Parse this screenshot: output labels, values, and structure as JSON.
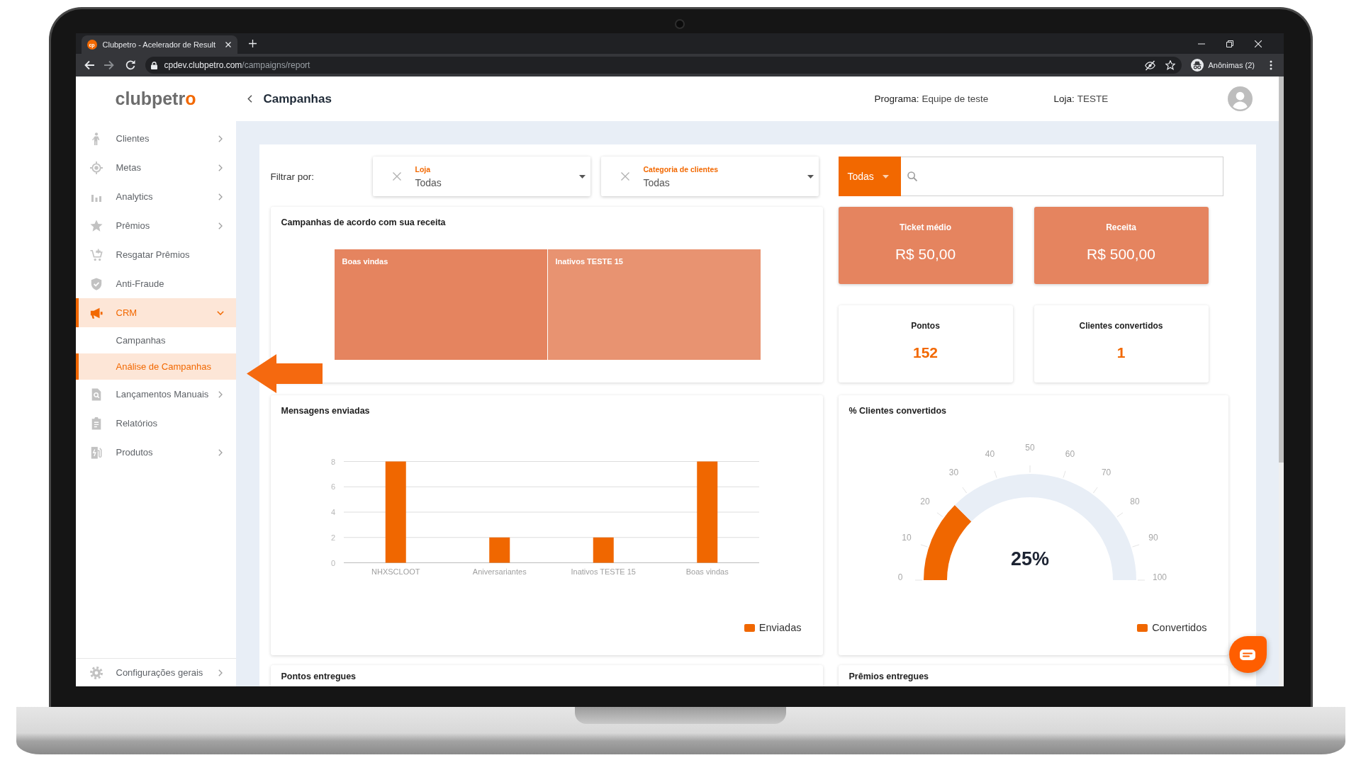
{
  "browser": {
    "favicon_text": "cp",
    "tab_title": "Clubpetro - Acelerador de Result",
    "url_host": "cpdev.clubpetro.com",
    "url_path": "/campaigns/report",
    "profile": "Anônimas (2)"
  },
  "sidebar": {
    "logo": "clubpetro",
    "items": [
      {
        "label": "Clientes",
        "expandable": true,
        "expanded": false,
        "selected": false
      },
      {
        "label": "Metas",
        "expandable": true,
        "expanded": false,
        "selected": false
      },
      {
        "label": "Analytics",
        "expandable": true,
        "expanded": false,
        "selected": false
      },
      {
        "label": "Prêmios",
        "expandable": true,
        "expanded": false,
        "selected": false
      },
      {
        "label": "Resgatar Prêmios",
        "expandable": false,
        "expanded": false,
        "selected": false
      },
      {
        "label": "Anti-Fraude",
        "expandable": false,
        "expanded": false,
        "selected": false
      },
      {
        "label": "CRM",
        "expandable": true,
        "expanded": true,
        "selected": true,
        "children": [
          {
            "label": "Campanhas",
            "selected": false
          },
          {
            "label": "Análise de Campanhas",
            "selected": true
          }
        ]
      },
      {
        "label": "Lançamentos Manuais",
        "expandable": true,
        "expanded": false,
        "selected": false
      },
      {
        "label": "Relatórios",
        "expandable": false,
        "expanded": false,
        "selected": false
      },
      {
        "label": "Produtos",
        "expandable": true,
        "expanded": false,
        "selected": false
      }
    ],
    "footer": {
      "label": "Configurações gerais",
      "expandable": true
    }
  },
  "header": {
    "title": "Campanhas",
    "program_label": "Programa:",
    "program": "Equipe de teste",
    "store_label": "Loja:",
    "store": "TESTE"
  },
  "filters": {
    "label": "Filtrar por:",
    "selects": [
      {
        "label": "Loja",
        "value": "Todas"
      },
      {
        "label": "Categoria de clientes",
        "value": "Todas"
      }
    ],
    "scope": "Todas"
  },
  "treemap": {
    "title": "Campanhas de acordo com sua receita",
    "tiles": [
      {
        "label": "Boas vindas",
        "color": "#e5845f"
      },
      {
        "label": "Inativos TESTE 15",
        "color": "#e89371"
      }
    ]
  },
  "kpis": [
    {
      "kind": "filled",
      "label": "Ticket médio",
      "value": "R$ 50,00"
    },
    {
      "kind": "filled",
      "label": "Receita",
      "value": "R$ 500,00"
    },
    {
      "kind": "plain",
      "label": "Pontos",
      "value": "152"
    },
    {
      "kind": "plain",
      "label": "Clientes convertidos",
      "value": "1"
    }
  ],
  "messages": {
    "chart_data": {
      "type": "bar",
      "title": "Mensagens enviadas",
      "categories": [
        "NHXSCLOOT",
        "Aniversariantes",
        "Inativos TESTE 15",
        "Boas vindas"
      ],
      "series": [
        {
          "name": "Enviadas",
          "color": "#f06700",
          "values": [
            8,
            2,
            2,
            8
          ]
        }
      ],
      "ylim": [
        0,
        8
      ],
      "yticks": [
        0,
        2,
        4,
        6,
        8
      ],
      "grid": true,
      "legend": "bottom-right"
    }
  },
  "conversion": {
    "chart_data": {
      "type": "donut",
      "title": "% Clientes convertidos",
      "categories": [
        "Convertidos",
        null
      ],
      "values": [
        25,
        75
      ],
      "colors": [
        "#f06700",
        "#e8eef6"
      ],
      "annotations": [
        "25%",
        "0",
        "10",
        "20",
        "30",
        "40",
        "50",
        "60",
        "70",
        "80",
        "90",
        "100"
      ],
      "legend": "bottom-right"
    }
  },
  "more_cards": [
    {
      "title": "Pontos entregues"
    },
    {
      "title": "Prêmios entregues"
    }
  ]
}
